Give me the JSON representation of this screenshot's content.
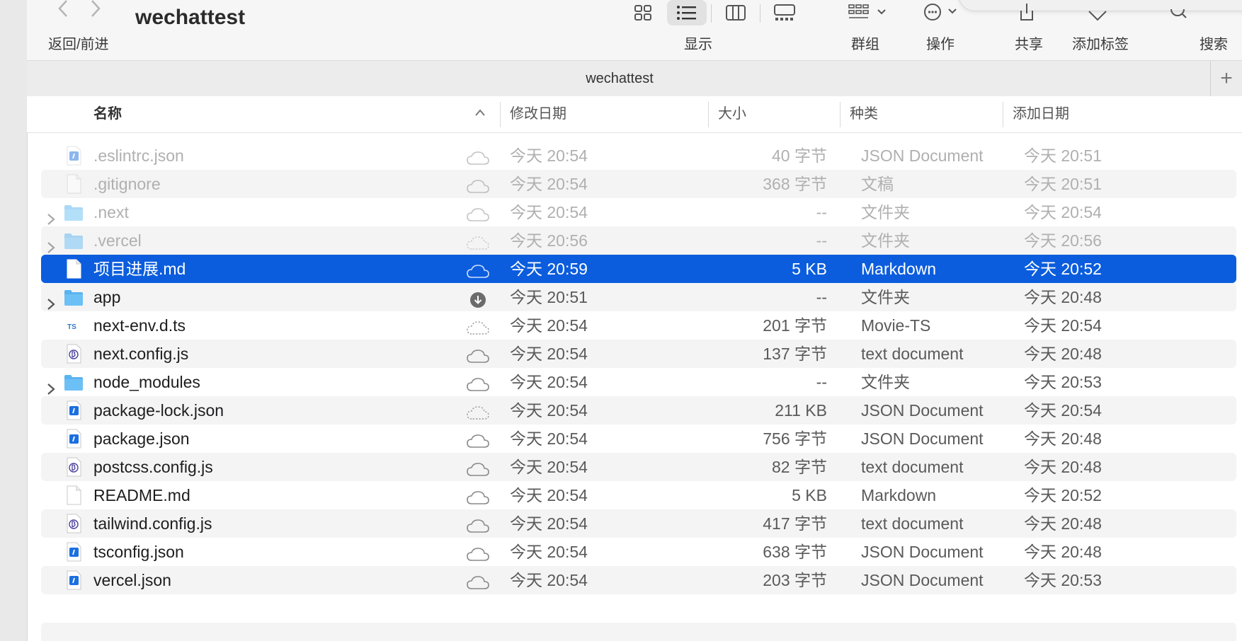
{
  "toolbar": {
    "nav_label": "返回/前进",
    "window_title": "wechattest",
    "display_label": "显示",
    "group_label": "群组",
    "action_label": "操作",
    "share_label": "共享",
    "tag_label": "添加标签",
    "search_label": "搜索"
  },
  "tab": {
    "title": "wechattest",
    "add": "+"
  },
  "columns": {
    "name": "名称",
    "modified": "修改日期",
    "size": "大小",
    "kind": "种类",
    "added": "添加日期"
  },
  "files": [
    {
      "name": ".eslintrc.json",
      "icon": "json-file-icon",
      "cloud": "cloud-icon",
      "modified": "今天 20:54",
      "size": "40 字节",
      "kind": "JSON Document",
      "added": "今天 20:51",
      "dim": true,
      "folder": false
    },
    {
      "name": ".gitignore",
      "icon": "blank-file-icon",
      "cloud": "cloud-icon",
      "modified": "今天 20:54",
      "size": "368 字节",
      "kind": "文稿",
      "added": "今天 20:51",
      "dim": true,
      "folder": false
    },
    {
      "name": ".next",
      "icon": "folder-icon",
      "cloud": "cloud-icon",
      "modified": "今天 20:54",
      "size": "--",
      "kind": "文件夹",
      "added": "今天 20:54",
      "dim": true,
      "folder": true
    },
    {
      "name": ".vercel",
      "icon": "folder-icon",
      "cloud": "cloud-dashed-icon",
      "modified": "今天 20:56",
      "size": "--",
      "kind": "文件夹",
      "added": "今天 20:56",
      "dim": true,
      "folder": true
    },
    {
      "name": "项目进展.md",
      "icon": "blank-file-icon",
      "cloud": "cloud-icon",
      "modified": "今天 20:59",
      "size": "5 KB",
      "kind": "Markdown",
      "added": "今天 20:52",
      "selected": true,
      "folder": false
    },
    {
      "name": "app",
      "icon": "folder-icon",
      "cloud": "download-icon",
      "modified": "今天 20:51",
      "size": "--",
      "kind": "文件夹",
      "added": "今天 20:48",
      "folder": true
    },
    {
      "name": "next-env.d.ts",
      "icon": "ts-file-icon",
      "cloud": "cloud-dashed-icon",
      "modified": "今天 20:54",
      "size": "201 字节",
      "kind": "Movie-TS",
      "added": "今天 20:54",
      "folder": false
    },
    {
      "name": "next.config.js",
      "icon": "js-file-icon",
      "cloud": "cloud-icon",
      "modified": "今天 20:54",
      "size": "137 字节",
      "kind": "text document",
      "added": "今天 20:48",
      "folder": false
    },
    {
      "name": "node_modules",
      "icon": "folder-icon",
      "cloud": "cloud-icon",
      "modified": "今天 20:54",
      "size": "--",
      "kind": "文件夹",
      "added": "今天 20:53",
      "folder": true
    },
    {
      "name": "package-lock.json",
      "icon": "json-file-icon",
      "cloud": "cloud-dashed-icon",
      "modified": "今天 20:54",
      "size": "211 KB",
      "kind": "JSON Document",
      "added": "今天 20:54",
      "folder": false
    },
    {
      "name": "package.json",
      "icon": "json-file-icon",
      "cloud": "cloud-icon",
      "modified": "今天 20:54",
      "size": "756 字节",
      "kind": "JSON Document",
      "added": "今天 20:48",
      "folder": false
    },
    {
      "name": "postcss.config.js",
      "icon": "js-file-icon",
      "cloud": "cloud-icon",
      "modified": "今天 20:54",
      "size": "82 字节",
      "kind": "text document",
      "added": "今天 20:48",
      "folder": false
    },
    {
      "name": "README.md",
      "icon": "blank-file-icon",
      "cloud": "cloud-icon",
      "modified": "今天 20:54",
      "size": "5 KB",
      "kind": "Markdown",
      "added": "今天 20:52",
      "folder": false
    },
    {
      "name": "tailwind.config.js",
      "icon": "js-file-icon",
      "cloud": "cloud-icon",
      "modified": "今天 20:54",
      "size": "417 字节",
      "kind": "text document",
      "added": "今天 20:48",
      "folder": false
    },
    {
      "name": "tsconfig.json",
      "icon": "json-file-icon",
      "cloud": "cloud-icon",
      "modified": "今天 20:54",
      "size": "638 字节",
      "kind": "JSON Document",
      "added": "今天 20:48",
      "folder": false
    },
    {
      "name": "vercel.json",
      "icon": "json-file-icon",
      "cloud": "cloud-icon",
      "modified": "今天 20:54",
      "size": "203 字节",
      "kind": "JSON Document",
      "added": "今天 20:53",
      "folder": false
    }
  ],
  "colors": {
    "selection": "#0b5ddd",
    "folder": "#5ab3f0",
    "accent_json": "#1b6fe0"
  }
}
